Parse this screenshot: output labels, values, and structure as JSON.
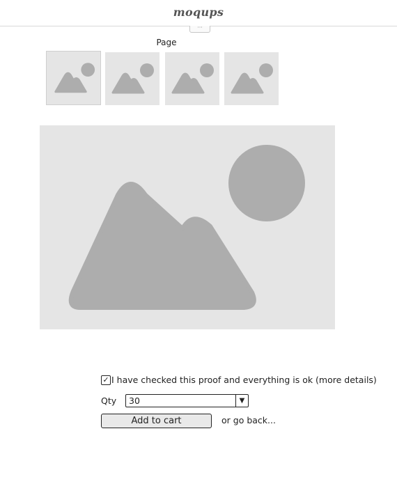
{
  "header": {
    "brand": "moqups"
  },
  "page": {
    "label": "Page"
  },
  "thumbnails": [
    {
      "icon": "image-placeholder-icon",
      "selected": true
    },
    {
      "icon": "image-placeholder-icon",
      "selected": false
    },
    {
      "icon": "image-placeholder-icon",
      "selected": false
    },
    {
      "icon": "image-placeholder-icon",
      "selected": false
    }
  ],
  "main_image": {
    "icon": "image-placeholder-icon"
  },
  "proof_check": {
    "checked": true,
    "label": "I have checked this proof and everything is ok (more details)"
  },
  "quantity": {
    "label": "Qty",
    "value": "30"
  },
  "actions": {
    "add_to_cart": "Add to cart",
    "go_back": "or go back..."
  },
  "colors": {
    "placeholder_bg": "#e5e5e5",
    "placeholder_shape": "#adadad"
  }
}
